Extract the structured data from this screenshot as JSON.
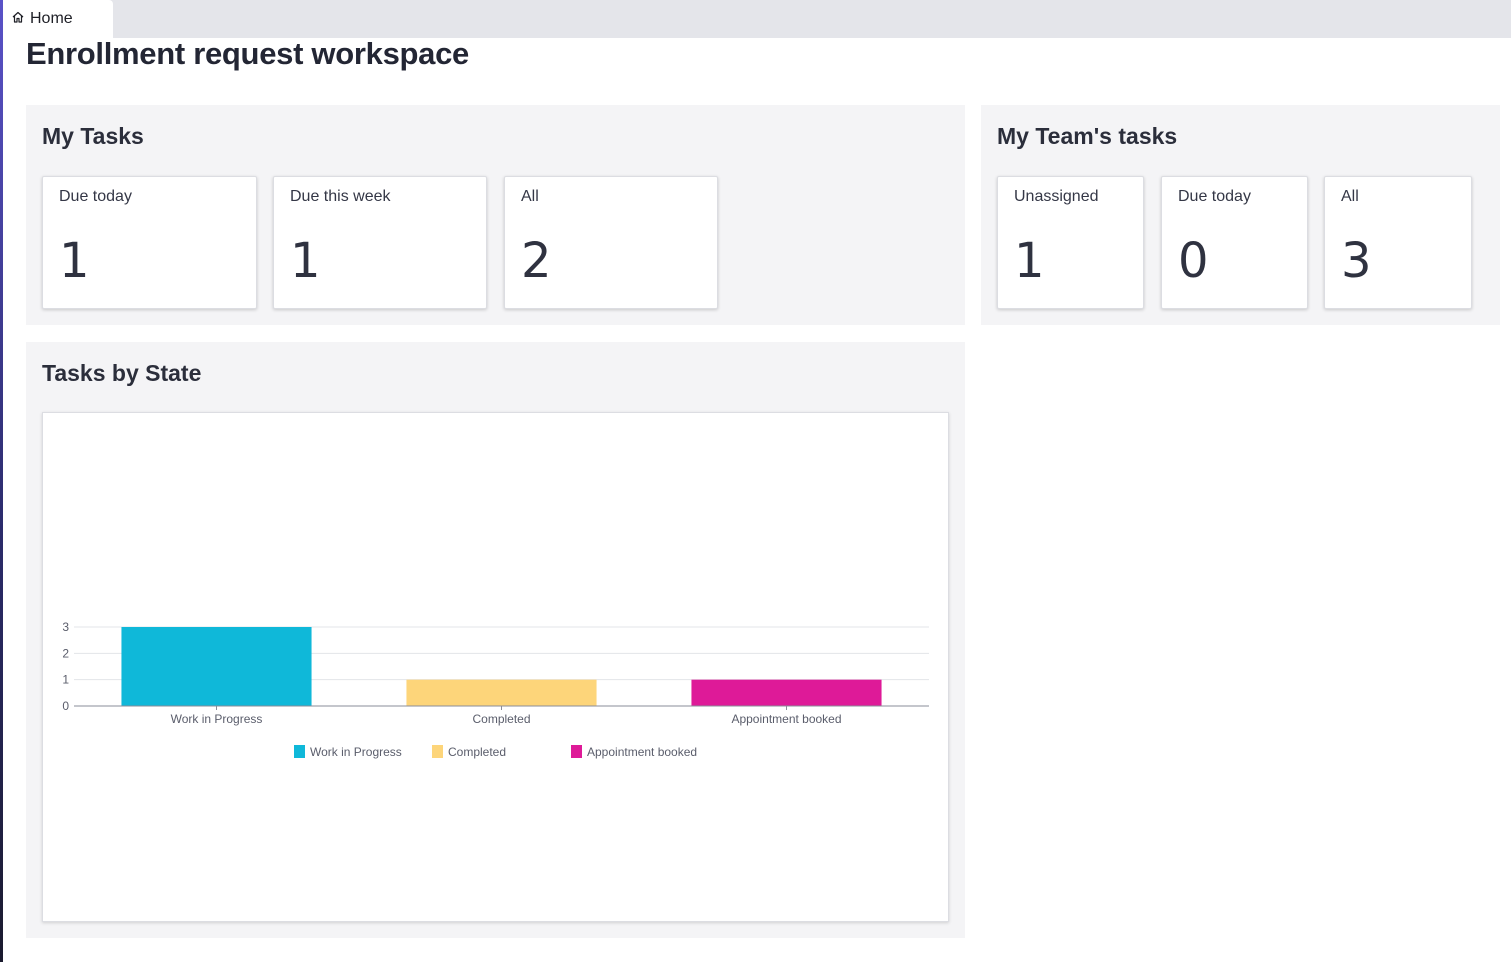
{
  "tab": {
    "label": "Home",
    "icon": "home-icon"
  },
  "page": {
    "title": "Enrollment request workspace"
  },
  "my_tasks": {
    "title": "My Tasks",
    "cards": [
      {
        "label": "Due today",
        "value": "1"
      },
      {
        "label": "Due this week",
        "value": "1"
      },
      {
        "label": "All",
        "value": "2"
      }
    ]
  },
  "team_tasks": {
    "title": "My Team's tasks",
    "cards": [
      {
        "label": "Unassigned",
        "value": "1"
      },
      {
        "label": "Due today",
        "value": "0"
      },
      {
        "label": "All",
        "value": "3"
      }
    ]
  },
  "state_panel": {
    "title": "Tasks by State"
  },
  "chart_data": {
    "type": "bar",
    "categories": [
      "Work in Progress",
      "Completed",
      "Appointment booked"
    ],
    "values": [
      3,
      1,
      1
    ],
    "colors": [
      "#0fb8d9",
      "#fdd57a",
      "#de1a98"
    ],
    "legend": [
      "Work in Progress",
      "Completed",
      "Appointment booked"
    ],
    "legend_position": "bottom",
    "yticks": [
      0,
      1,
      2,
      3
    ],
    "ylim": [
      0,
      3
    ],
    "grid": true,
    "title": "",
    "xlabel": "",
    "ylabel": ""
  }
}
